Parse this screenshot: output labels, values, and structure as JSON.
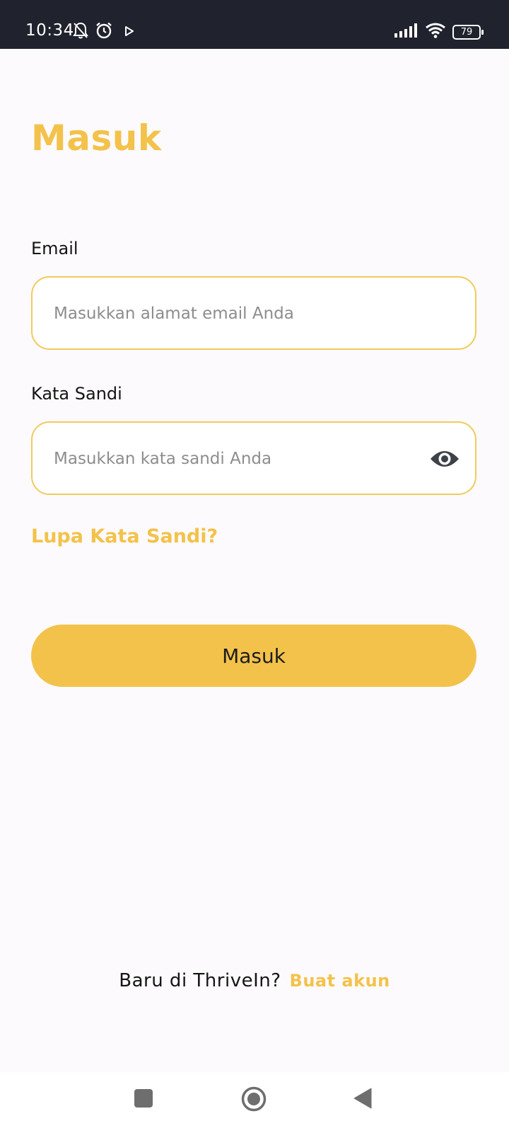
{
  "status_bar": {
    "time": "10:34",
    "battery": "79",
    "icons": [
      "bell-off-icon",
      "alarm-icon",
      "play-icon",
      "signal-icon",
      "wifi-icon",
      "battery-icon"
    ]
  },
  "page": {
    "title": "Masuk"
  },
  "form": {
    "email_label": "Email",
    "email_placeholder": "Masukkan alamat email Anda",
    "email_value": "",
    "password_label": "Kata Sandi",
    "password_placeholder": "Masukkan kata sandi Anda",
    "password_value": "",
    "forgot_link": "Lupa Kata Sandi?",
    "submit_label": "Masuk"
  },
  "footer": {
    "prompt": "Baru di ThriveIn?",
    "signup_link": "Buat akun"
  },
  "nav_bar": {
    "buttons": [
      "recents-icon",
      "home-icon",
      "back-icon"
    ]
  },
  "colors": {
    "accent": "#f3c24a",
    "field_border": "#f0cb5c",
    "status_bar_bg": "#20222d",
    "background": "#fcfafc"
  }
}
